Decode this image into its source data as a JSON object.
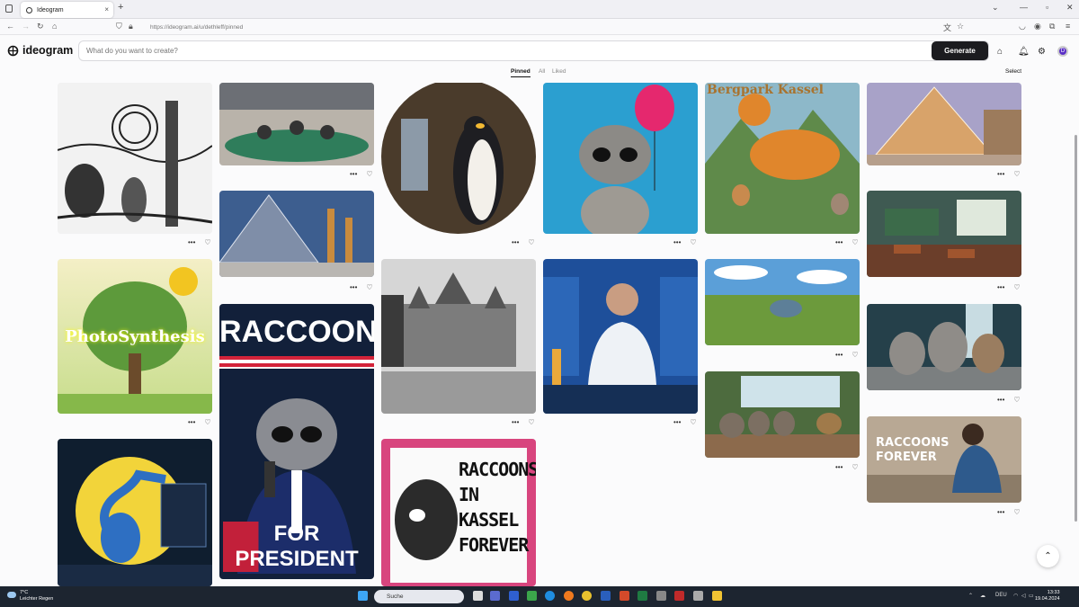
{
  "browser": {
    "tab_title": "Ideogram",
    "tab_close": "×",
    "new_tab": "+",
    "url": "https://ideogram.ai/u/dethleff/pinned"
  },
  "header": {
    "logo_text": "ideogram",
    "prompt_placeholder": "What do you want to create?",
    "generate_label": "Generate",
    "avatar_letter": "D"
  },
  "filters": {
    "pinned": "Pinned",
    "all": "All",
    "liked": "Liked",
    "select": "Select"
  },
  "cards": {
    "photosynthesis": "PhotoSynthesis",
    "raccoon_top": "RACCOON",
    "raccoon_bottom": "FOR PRESIDENT",
    "kassel_title": "RACCOONS IN KASSEL FOREVER",
    "bergpark": "Bergpark Kassel",
    "raccoons_forever": "RACCOONS FOREVER"
  },
  "taskbar": {
    "temp": "7°C",
    "weather": "Leichter Regen",
    "search": "Suche",
    "lang": "DEU",
    "time": "13:33",
    "date": "19.04.2024"
  }
}
